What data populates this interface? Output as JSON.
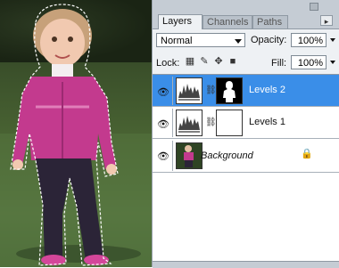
{
  "panel": {
    "tabs": [
      "Layers",
      "Channels",
      "Paths"
    ],
    "blend_mode": "Normal",
    "opacity_label": "Opacity:",
    "opacity_value": "100%",
    "lock_label": "Lock:",
    "fill_label": "Fill:",
    "fill_value": "100%",
    "layers": [
      {
        "name": "Levels 2",
        "selected": true,
        "has_mask": true
      },
      {
        "name": "Levels 1",
        "selected": false,
        "has_mask": true
      },
      {
        "name": "Background",
        "selected": false,
        "locked": true
      }
    ]
  }
}
